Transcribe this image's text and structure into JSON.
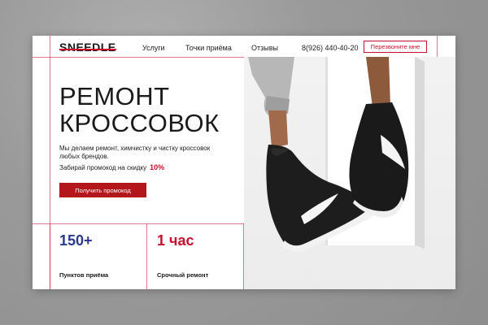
{
  "header": {
    "logo": "SNEEDLE",
    "nav": [
      "Услуги",
      "Точки приёма",
      "Отзывы"
    ],
    "phone": "8(926) 440-40-20",
    "callback_label": "Перезвоните мне"
  },
  "hero": {
    "title_line1": "РЕМОНТ",
    "title_line2": "КРОССОВОК",
    "description": "Мы делаем ремонт, химчистку и чистку кроссовок любых брендов.",
    "promo_text": "Забирай промокод на скидку",
    "promo_value": "10%",
    "cta_label": "Получить промокод"
  },
  "stats": [
    {
      "value": "150+",
      "label": "Пунктов приёма",
      "color": "#2b3a8f"
    },
    {
      "value": "1 час",
      "label": "Срочный ремонт",
      "color": "#c8102e"
    }
  ],
  "colors": {
    "accent": "#c8102e",
    "button": "#b3161b",
    "stat_blue": "#2b3a8f",
    "text": "#1a1a1a"
  },
  "icons": [
    "sneaker-photo"
  ]
}
